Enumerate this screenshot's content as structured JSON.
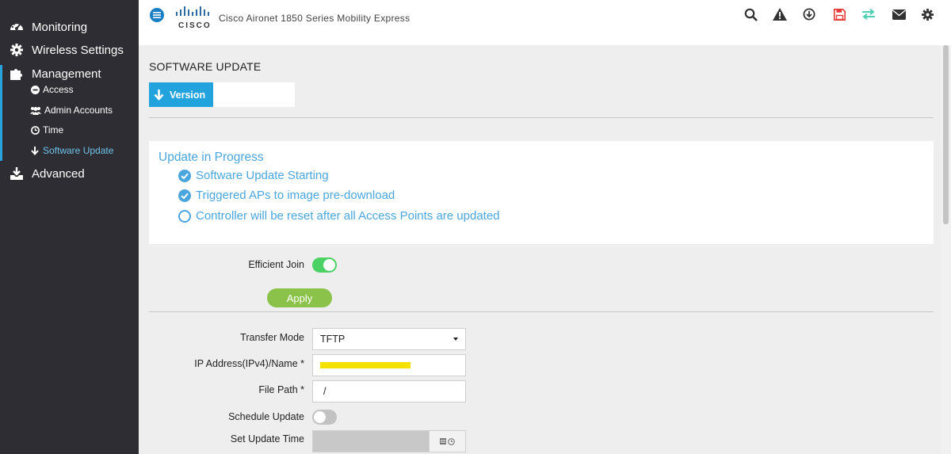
{
  "header": {
    "title": "Cisco Aironet 1850 Series Mobility Express",
    "logo_text": "CISCO",
    "icons": [
      "search-icon",
      "warning-icon",
      "download-icon",
      "save-icon",
      "transfer-icon",
      "mail-icon",
      "gear-icon"
    ]
  },
  "sidebar": {
    "items": [
      {
        "label": "Monitoring",
        "icon": "dashboard-icon"
      },
      {
        "label": "Wireless Settings",
        "icon": "gear-icon"
      },
      {
        "label": "Management",
        "icon": "puzzle-icon"
      },
      {
        "label": "Advanced",
        "icon": "download-tray-icon"
      }
    ],
    "management_sub": [
      {
        "label": "Access",
        "icon": "minus-circle-icon"
      },
      {
        "label": "Admin Accounts",
        "icon": "users-icon"
      },
      {
        "label": "Time",
        "icon": "clock-icon"
      },
      {
        "label": "Software Update",
        "icon": "arrow-down-icon",
        "active": true
      }
    ]
  },
  "main": {
    "page_title": "SOFTWARE UPDATE",
    "tab_label": "Version",
    "progress": {
      "title": "Update in Progress",
      "steps": [
        {
          "label": "Software Update Starting",
          "done": true
        },
        {
          "label": "Triggered APs to image pre-download",
          "done": true
        },
        {
          "label": "Controller will be reset after all Access Points are updated",
          "done": false
        }
      ]
    },
    "efficient_join": {
      "label": "Efficient Join",
      "on": true
    },
    "apply_label": "Apply",
    "form": {
      "transfer_mode_label": "Transfer Mode",
      "transfer_mode_value": "TFTP",
      "ip_label": "IP Address(IPv4)/Name *",
      "file_path_label": "File Path *",
      "file_path_value": "/",
      "schedule_label": "Schedule Update",
      "schedule_on": false,
      "set_time_label": "Set Update Time"
    }
  },
  "colors": {
    "accent": "#23a3dd",
    "progress_text": "#4aa6dd",
    "toggle_on": "#4cd164",
    "apply": "#8bc34a",
    "save_icon": "#e53935",
    "transfer_icon": "#4fd1b5",
    "redaction": "#f5e100"
  }
}
